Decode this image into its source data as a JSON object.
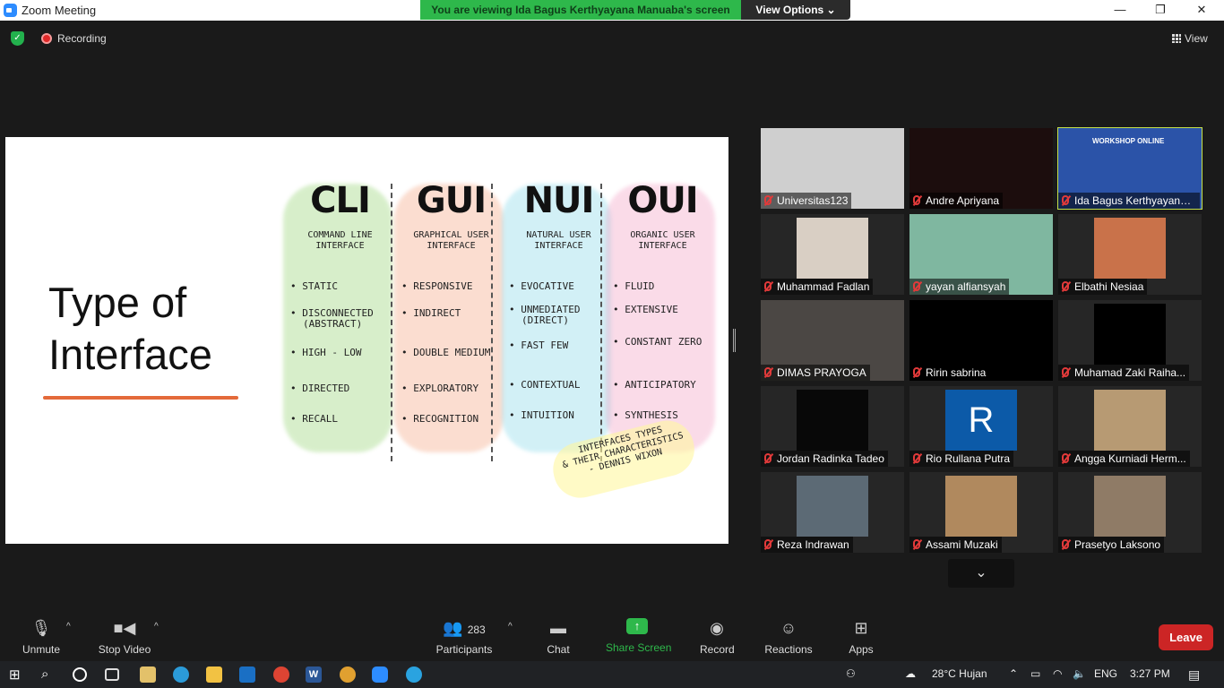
{
  "window": {
    "title": "Zoom Meeting",
    "viewing_banner": "You are viewing Ida Bagus Kerthyayana Manuaba's screen",
    "view_options": "View Options ⌄",
    "min": "—",
    "max": "❐",
    "close": "✕"
  },
  "topbar": {
    "recording": "Recording",
    "view": "View"
  },
  "slide": {
    "title_line1": "Type of",
    "title_line2": "Interface",
    "columns": [
      {
        "head": "CLI",
        "sub1": "COMMAND LINE",
        "sub2": "INTERFACE",
        "color": "#8fd16a",
        "items": [
          "STATIC",
          "DISCONNECTED",
          "(ABSTRACT)",
          "HIGH - LOW",
          "DIRECTED",
          "RECALL"
        ]
      },
      {
        "head": "GUI",
        "sub1": "GRAPHICAL USER",
        "sub2": "INTERFACE",
        "color": "#f4a07a",
        "items": [
          "RESPONSIVE",
          "INDIRECT",
          "DOUBLE MEDIUM",
          "EXPLORATORY",
          "RECOGNITION"
        ]
      },
      {
        "head": "NUI",
        "sub1": "NATURAL USER",
        "sub2": "INTERFACE",
        "color": "#7fd6e8",
        "items": [
          "EVOCATIVE",
          "UNMEDIATED",
          "(DIRECT)",
          "FAST FEW",
          "CONTEXTUAL",
          "INTUITION"
        ]
      },
      {
        "head": "OUI",
        "sub1": "ORGANIC USER",
        "sub2": "INTERFACE",
        "color": "#f29ac0",
        "items": [
          "FLUID",
          "EXTENSIVE",
          "CONSTANT ZERO",
          "ANTICIPATORY",
          "SYNTHESIS"
        ]
      }
    ],
    "credit_line1": "INTERFACES TYPES",
    "credit_line2": "& THEIR CHARACTERISTICS",
    "credit_line3": "- DENNIS WIXON"
  },
  "participants_tiles": [
    {
      "name": "Universitas123",
      "bg": "#cfcfcf"
    },
    {
      "name": "Andre Apriyana",
      "bg": "#1c0d0d"
    },
    {
      "name": "Ida Bagus Kerthyayana ...",
      "bg": "#2b53a8",
      "badge": "WORKSHOP ONLINE"
    },
    {
      "name": "Muhammad Fadlan",
      "bg": "#d9cfc4"
    },
    {
      "name": "yayan alfiansyah",
      "bg": "#7fb7a0"
    },
    {
      "name": "Elbathi Nesiaa",
      "bg": "#c9724a"
    },
    {
      "name": "DIMAS PRAYOGA",
      "bg": "#4b4744"
    },
    {
      "name": "Ririn sabrina",
      "bg": "#000000"
    },
    {
      "name": "Muhamad Zaki Raiha...",
      "bg": "#000000"
    },
    {
      "name": "Jordan Radinka Tadeo",
      "bg": "#080808"
    },
    {
      "name": "Rio Rullana Putra",
      "bg": "#0c5aa8",
      "letter": "R"
    },
    {
      "name": "Angga Kurniadi Herm...",
      "bg": "#b79a73"
    },
    {
      "name": "Reza Indrawan",
      "bg": "#5c6a75"
    },
    {
      "name": "Assami Muzaki",
      "bg": "#b0895e"
    },
    {
      "name": "Prasetyo Laksono",
      "bg": "#8f7b66"
    }
  ],
  "toolbar": {
    "unmute": "Unmute",
    "stop_video": "Stop Video",
    "participants": "Participants",
    "participants_count": "283",
    "chat": "Chat",
    "share_screen": "Share Screen",
    "record": "Record",
    "reactions": "Reactions",
    "apps": "Apps",
    "leave": "Leave"
  },
  "taskbar": {
    "weather": "28°C  Hujan",
    "lang": "ENG",
    "time": "3:27 PM"
  }
}
